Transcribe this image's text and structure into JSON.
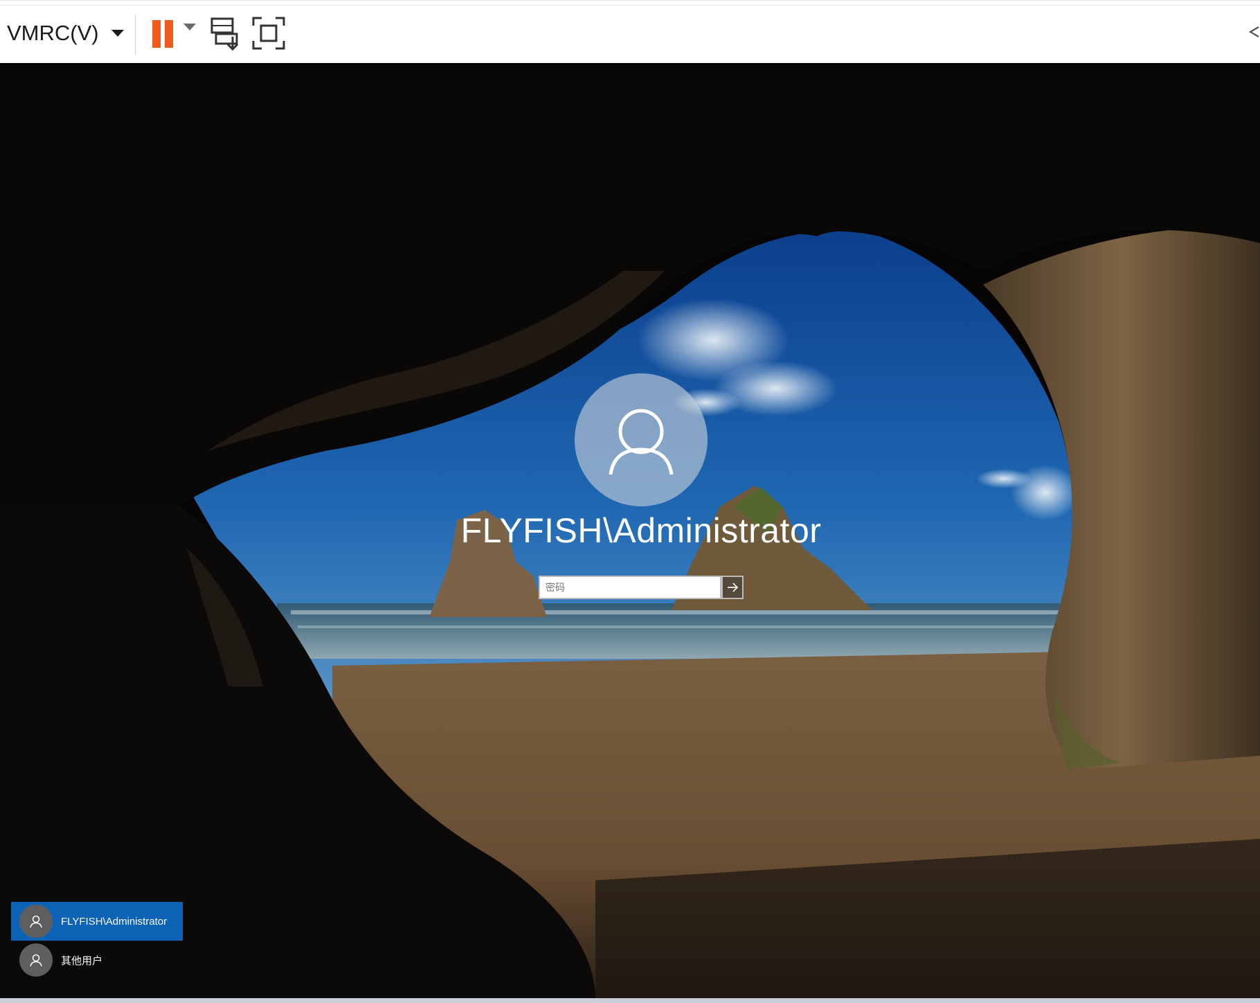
{
  "toolbar": {
    "menu_label": "VMRC(V)",
    "icons": [
      "chevron-down-icon",
      "pause-icon",
      "send-ctrl-alt-del-icon",
      "fullscreen-icon",
      "collapse-arrow-icon"
    ],
    "accent_color": "#f25a1e"
  },
  "login": {
    "username": "FLYFISH\\Administrator",
    "password_placeholder": "密码",
    "submit_icon": "arrow-right-icon"
  },
  "user_list": [
    {
      "label": "FLYFISH\\Administrator",
      "selected": true
    },
    {
      "label": "其他用户",
      "selected": false
    }
  ],
  "tray_icons": [
    "network-warning-icon",
    "power-icon"
  ],
  "colors": {
    "selected_user": "#0d63b5"
  }
}
